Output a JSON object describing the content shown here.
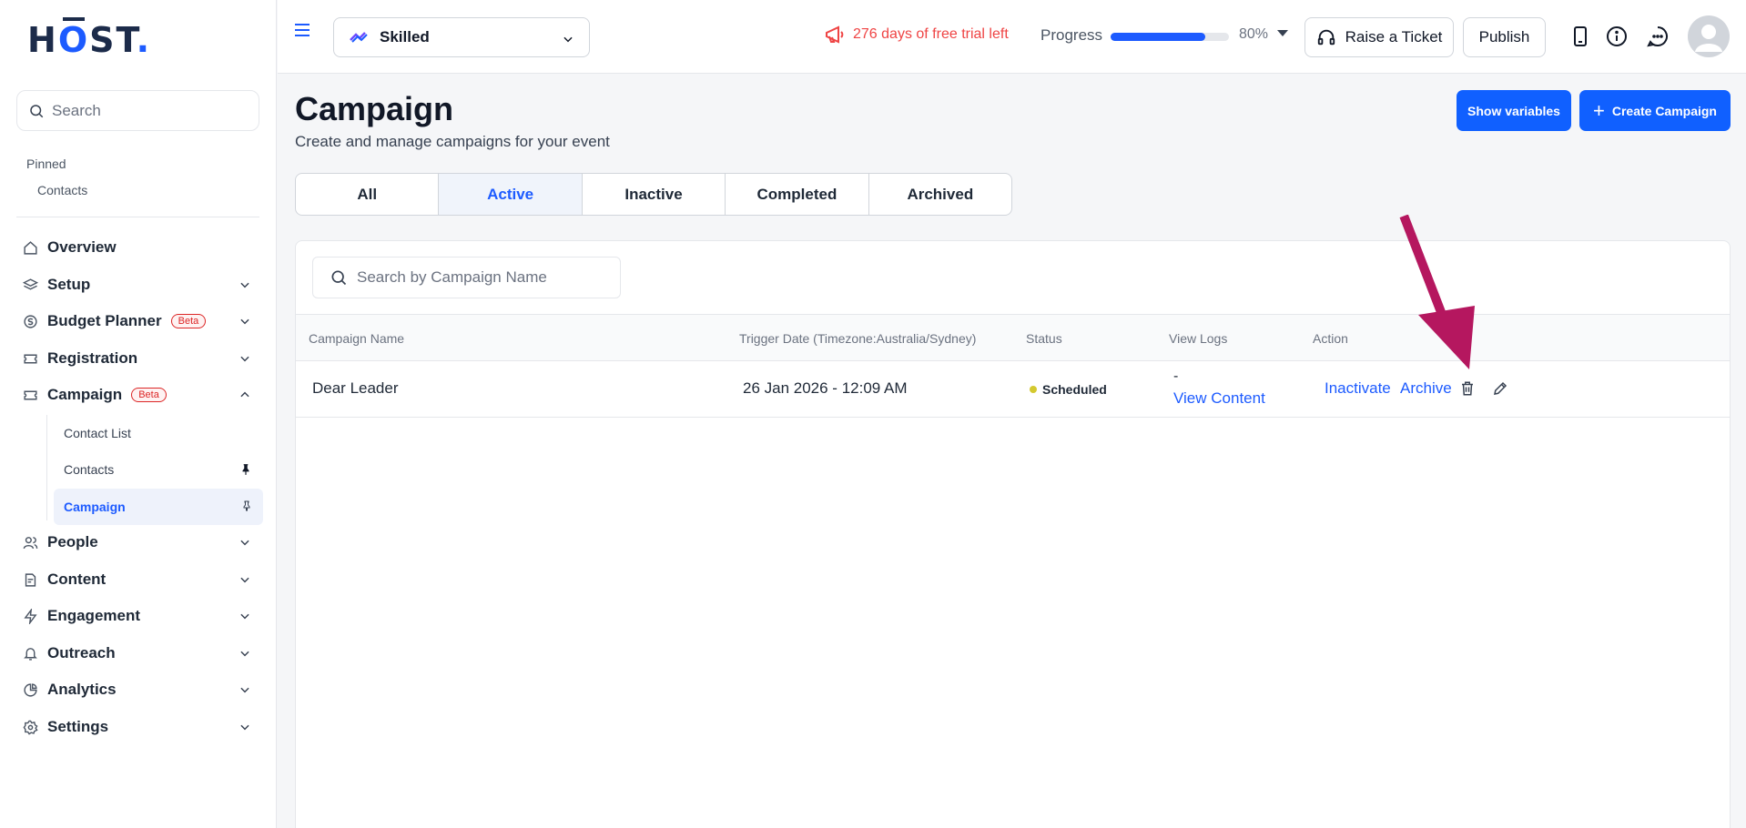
{
  "brand": {
    "logo_h": "H",
    "logo_o": "O",
    "logo_st": "ST",
    "logo_dot": "."
  },
  "sidebar": {
    "search_placeholder": "Search",
    "pinned_title": "Pinned",
    "pinned_items": [
      "Contacts"
    ],
    "nav": [
      {
        "label": "Overview",
        "icon": "home-icon"
      },
      {
        "label": "Setup",
        "icon": "layers-icon"
      },
      {
        "label": "Budget Planner",
        "icon": "dollar-circle-icon",
        "badge": "Beta"
      },
      {
        "label": "Registration",
        "icon": "ticket-icon"
      },
      {
        "label": "Campaign",
        "icon": "ticket-icon",
        "badge": "Beta"
      },
      {
        "label": "People",
        "icon": "users-icon"
      },
      {
        "label": "Content",
        "icon": "document-icon"
      },
      {
        "label": "Engagement",
        "icon": "bolt-icon"
      },
      {
        "label": "Outreach",
        "icon": "bell-icon"
      },
      {
        "label": "Analytics",
        "icon": "pie-chart-icon"
      },
      {
        "label": "Settings",
        "icon": "gear-icon"
      }
    ],
    "campaign_sub": [
      {
        "label": "Contact List"
      },
      {
        "label": "Contacts"
      },
      {
        "label": "Campaign"
      }
    ]
  },
  "topbar": {
    "event_name": "Skilled",
    "trial_text": "276 days of free trial left",
    "progress_label": "Progress",
    "progress_value": "80%",
    "progress_fraction": 0.8,
    "ticket_label": "Raise a Ticket",
    "publish_label": "Publish"
  },
  "main": {
    "title": "Campaign",
    "subtitle": "Create and manage campaigns for your event",
    "show_variables_label": "Show variables",
    "create_label": "Create Campaign",
    "tabs": [
      "All",
      "Active",
      "Inactive",
      "Completed",
      "Archived"
    ],
    "active_tab": "Active",
    "search_placeholder": "Search by Campaign Name",
    "table": {
      "headers": [
        "Campaign Name",
        "Trigger Date (Timezone:Australia/Sydney)",
        "Status",
        "View Logs",
        "Action"
      ],
      "rows": [
        {
          "name": "Dear Leader",
          "trigger_date": "26 Jan 2026 - 12:09 AM",
          "status": "Scheduled",
          "logs_dash": "-",
          "logs_link": "View Content",
          "action_inactivate": "Inactivate",
          "action_archive": "Archive"
        }
      ]
    }
  },
  "colors": {
    "accent": "#1d5bff",
    "primary_button": "#1060ff",
    "trial": "#ef4444",
    "annotation_arrow": "#b5175f",
    "status_scheduled": "#d4c92f"
  }
}
